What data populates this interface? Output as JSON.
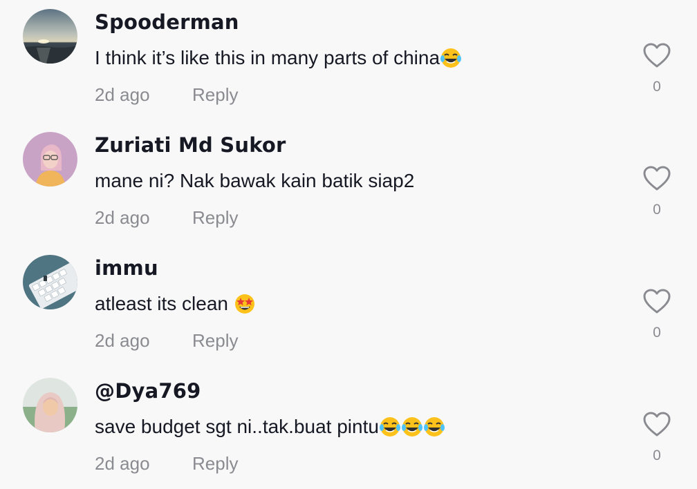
{
  "comments": [
    {
      "username": "Spooderman",
      "text": "I think it’s like this in many parts of china",
      "emojis": [
        "face-with-tears-of-joy"
      ],
      "time": "2d ago",
      "reply_label": "Reply",
      "like_count": "0"
    },
    {
      "username": "Zuriati Md Sukor",
      "text": "mane ni? Nak bawak kain batik siap2",
      "emojis": [],
      "time": "2d ago",
      "reply_label": "Reply",
      "like_count": "0"
    },
    {
      "username": "immu",
      "text": "atleast its clean",
      "emojis": [
        "star-struck"
      ],
      "time": "2d ago",
      "reply_label": "Reply",
      "like_count": "0"
    },
    {
      "username": "@Dya769",
      "text": "save budget sgt ni..tak.buat pintu",
      "emojis": [
        "face-with-tears-of-joy",
        "face-with-tears-of-joy",
        "face-with-tears-of-joy"
      ],
      "time": "2d ago",
      "reply_label": "Reply",
      "like_count": "0"
    }
  ],
  "colors": {
    "background": "#f8f8f8",
    "primary_text": "#161823",
    "secondary_text": "#8a8b91",
    "like_outline": "#8a8b91"
  }
}
